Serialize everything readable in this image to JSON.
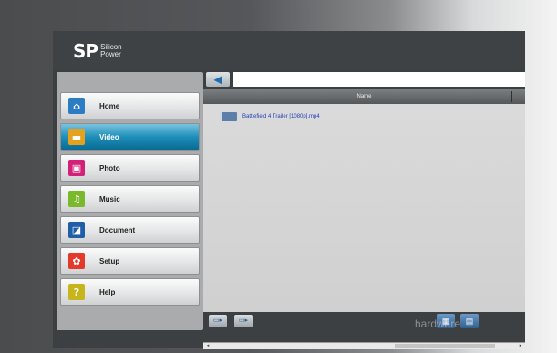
{
  "brand": {
    "mark": "SP",
    "line1": "Silicon",
    "line2": "Power"
  },
  "sidebar": {
    "items": [
      {
        "label": "Home",
        "icon": "home-icon",
        "color": "#2b7cc3",
        "glyph": "⌂"
      },
      {
        "label": "Video",
        "icon": "video-icon",
        "color": "#e6a21d",
        "glyph": "▬",
        "active": true
      },
      {
        "label": "Photo",
        "icon": "photo-icon",
        "color": "#d3217a",
        "glyph": "▣"
      },
      {
        "label": "Music",
        "icon": "music-icon",
        "color": "#7ab82c",
        "glyph": "♫"
      },
      {
        "label": "Document",
        "icon": "document-icon",
        "color": "#1f5fa8",
        "glyph": "◪"
      },
      {
        "label": "Setup",
        "icon": "setup-icon",
        "color": "#e43a2c",
        "glyph": "✿"
      },
      {
        "label": "Help",
        "icon": "help-icon",
        "color": "#c7b51e",
        "glyph": "?"
      }
    ]
  },
  "content": {
    "path_value": "",
    "column_header": "Name",
    "files": [
      {
        "name": "Battlefield 4 Trailer [1080p].mp4"
      }
    ]
  },
  "watermark": "hardware",
  "colors": {
    "accent": "#1d8fba",
    "link": "#1f3fb8"
  }
}
